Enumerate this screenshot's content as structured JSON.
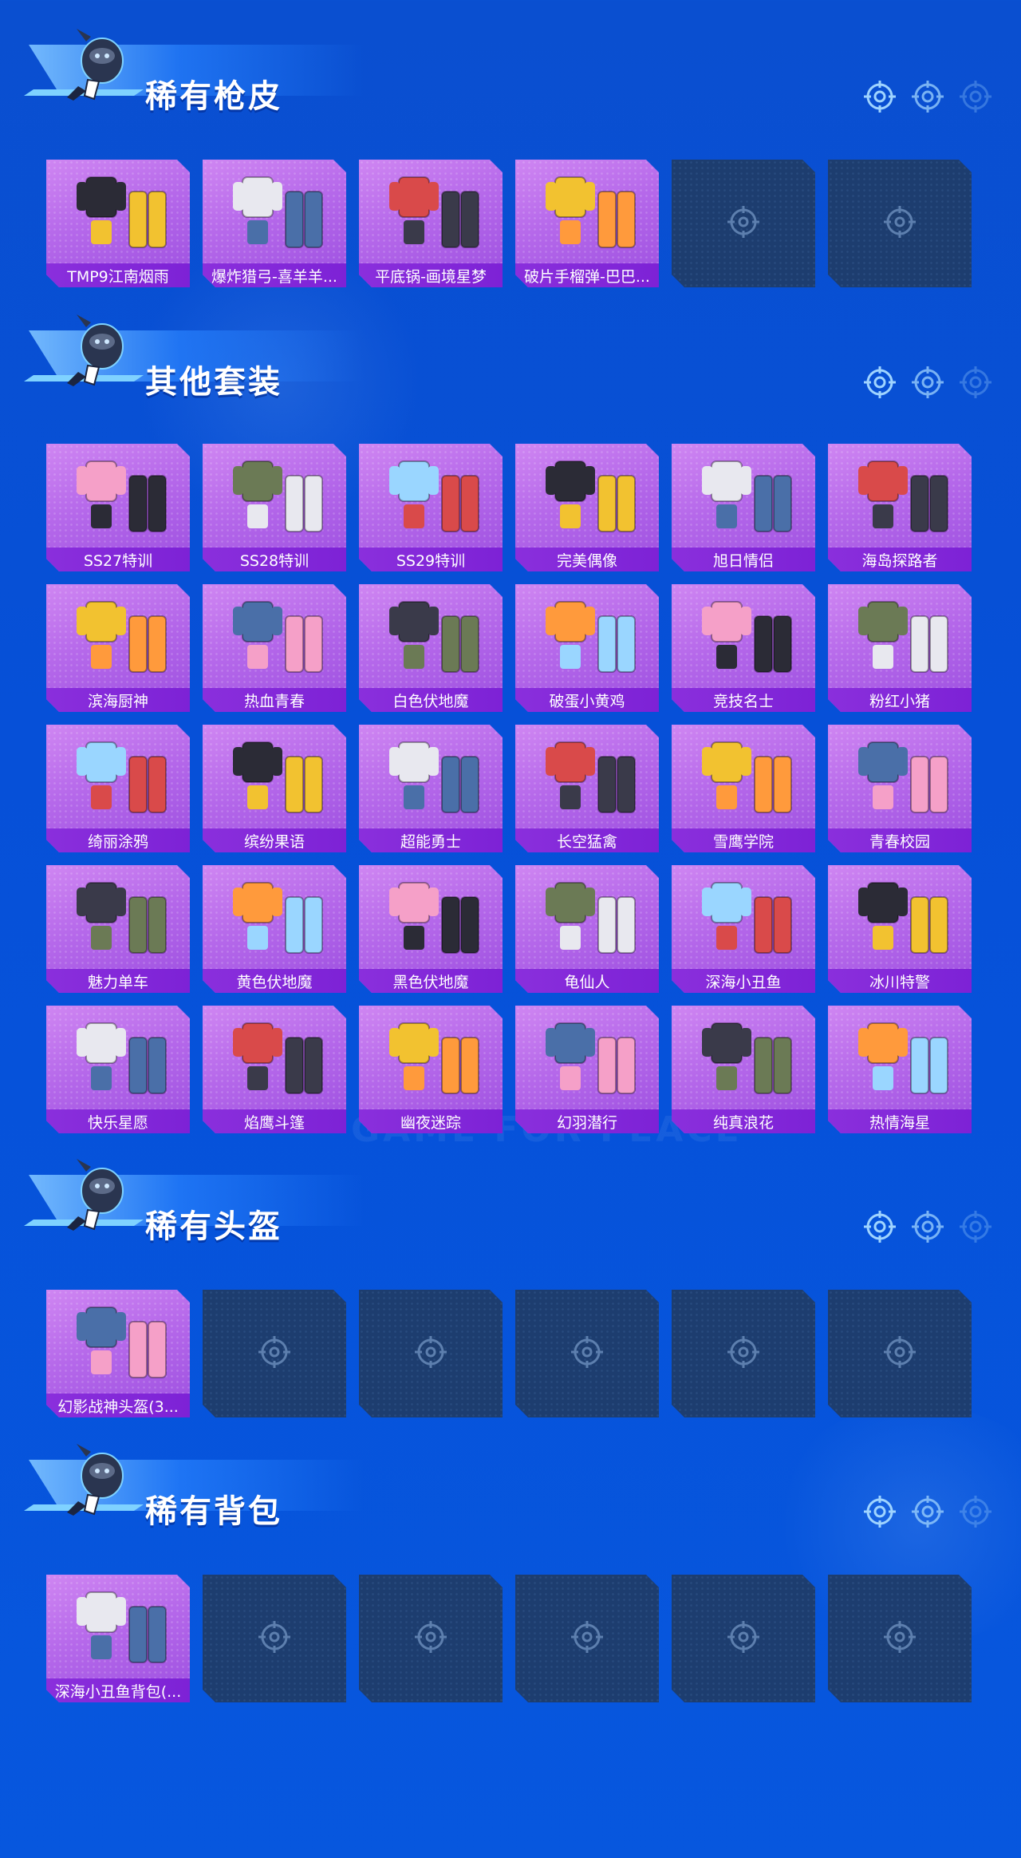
{
  "sections": [
    {
      "title": "稀有枪皮",
      "items": [
        "TMP9江南烟雨",
        "爆炸猎弓-喜羊羊...",
        "平底锅-画境星梦",
        "破片手榴弹-巴巴...",
        null,
        null
      ]
    },
    {
      "title": "其他套装",
      "items": [
        "SS27特训",
        "SS28特训",
        "SS29特训",
        "完美偶像",
        "旭日情侣",
        "海岛探路者",
        "滨海厨神",
        "热血青春",
        "白色伏地魔",
        "破蛋小黄鸡",
        "竞技名士",
        "粉红小猪",
        "绮丽涂鸦",
        "缤纷果语",
        "超能勇士",
        "长空猛禽",
        "雪鹰学院",
        "青春校园",
        "魅力单车",
        "黄色伏地魔",
        "黑色伏地魔",
        "龟仙人",
        "深海小丑鱼",
        "冰川特警",
        "快乐星愿",
        "焰鹰斗篷",
        "幽夜迷踪",
        "幻羽潜行",
        "纯真浪花",
        "热情海星"
      ]
    },
    {
      "title": "稀有头盔",
      "items": [
        "幻影战神头盔(3...",
        null,
        null,
        null,
        null,
        null
      ]
    },
    {
      "title": "稀有背包",
      "items": [
        "深海小丑鱼背包(...",
        null,
        null,
        null,
        null,
        null
      ]
    }
  ],
  "watermark": "GAME FOR PEACE",
  "colors": {
    "background": "#0650d8",
    "card_filled": "#b568ea",
    "card_label": "#8a2fdc",
    "card_empty": "#1d3d6f"
  }
}
